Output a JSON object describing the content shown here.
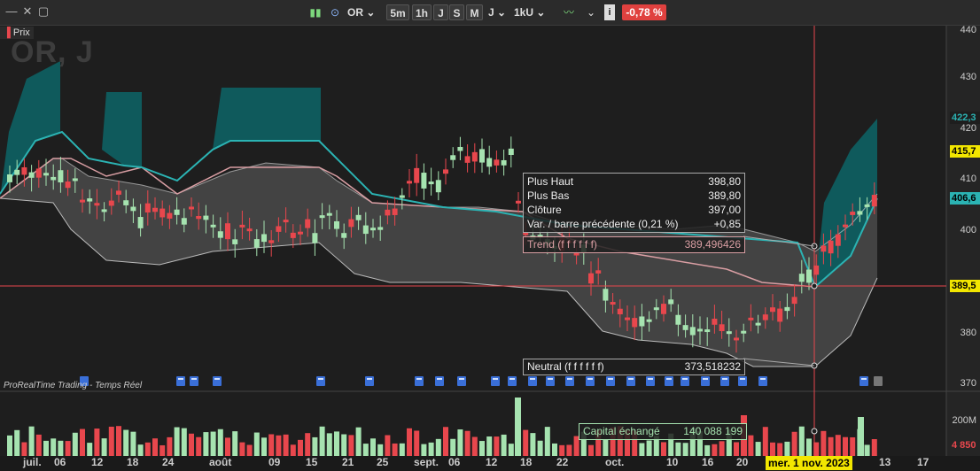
{
  "toolbar": {
    "window_controls": [
      "—",
      "✕",
      "▢"
    ],
    "symbol": "OR",
    "timeframes": [
      "5m",
      "1h",
      "J",
      "S",
      "M"
    ],
    "period": "J",
    "units": "1kU",
    "change": "-0,78 %",
    "change_color": "#e0413f",
    "info_icon": "i"
  },
  "chart": {
    "pane_label": "Prix",
    "watermark": "OR, J",
    "source": "ProRealTime Trading - Temps Réel",
    "y_ticks": [
      "440",
      "430",
      "420",
      "410",
      "400",
      "380",
      "370"
    ],
    "y_boxes": [
      {
        "value": "422,3",
        "color": "#2bb3b3",
        "bg": "#1e1e1e"
      },
      {
        "value": "415,7",
        "color": "#000000",
        "bg": "#f2e600"
      },
      {
        "value": "406,6",
        "color": "#000000",
        "bg": "#2bb3b3"
      },
      {
        "value": "389,5",
        "color": "#000000",
        "bg": "#f2e600"
      }
    ],
    "x_ticks": [
      "juil.",
      "06",
      "12",
      "18",
      "24",
      "août",
      "09",
      "15",
      "21",
      "25",
      "sept.",
      "06",
      "12",
      "18",
      "22",
      "oct.",
      "10",
      "16",
      "20",
      "13",
      "17"
    ],
    "cursor_date": "mer. 1 nov. 2023",
    "vol_ticks": [
      "200M",
      "4 850"
    ],
    "colors": {
      "up": "#a6e3b0",
      "down": "#e8474d",
      "band_fill": "#0f5a5c",
      "teal": "#2bb3b3",
      "pink": "#d99ea3"
    }
  },
  "tooltip": {
    "rows": [
      {
        "label": "Plus Haut",
        "value": "398,80"
      },
      {
        "label": "Plus Bas",
        "value": "389,80"
      },
      {
        "label": "Clôture",
        "value": "397,00"
      },
      {
        "label": "Var. / barre précédente (0,21 %)",
        "value": "+0,85"
      }
    ],
    "trend_label": "Trend (f f f f f f)",
    "trend_value": "389,496426",
    "neutral_label": "Neutral (f f f f f f)",
    "neutral_value": "373,518232",
    "volume_label": "Capital échangé",
    "volume_value": "140 088 199"
  }
}
